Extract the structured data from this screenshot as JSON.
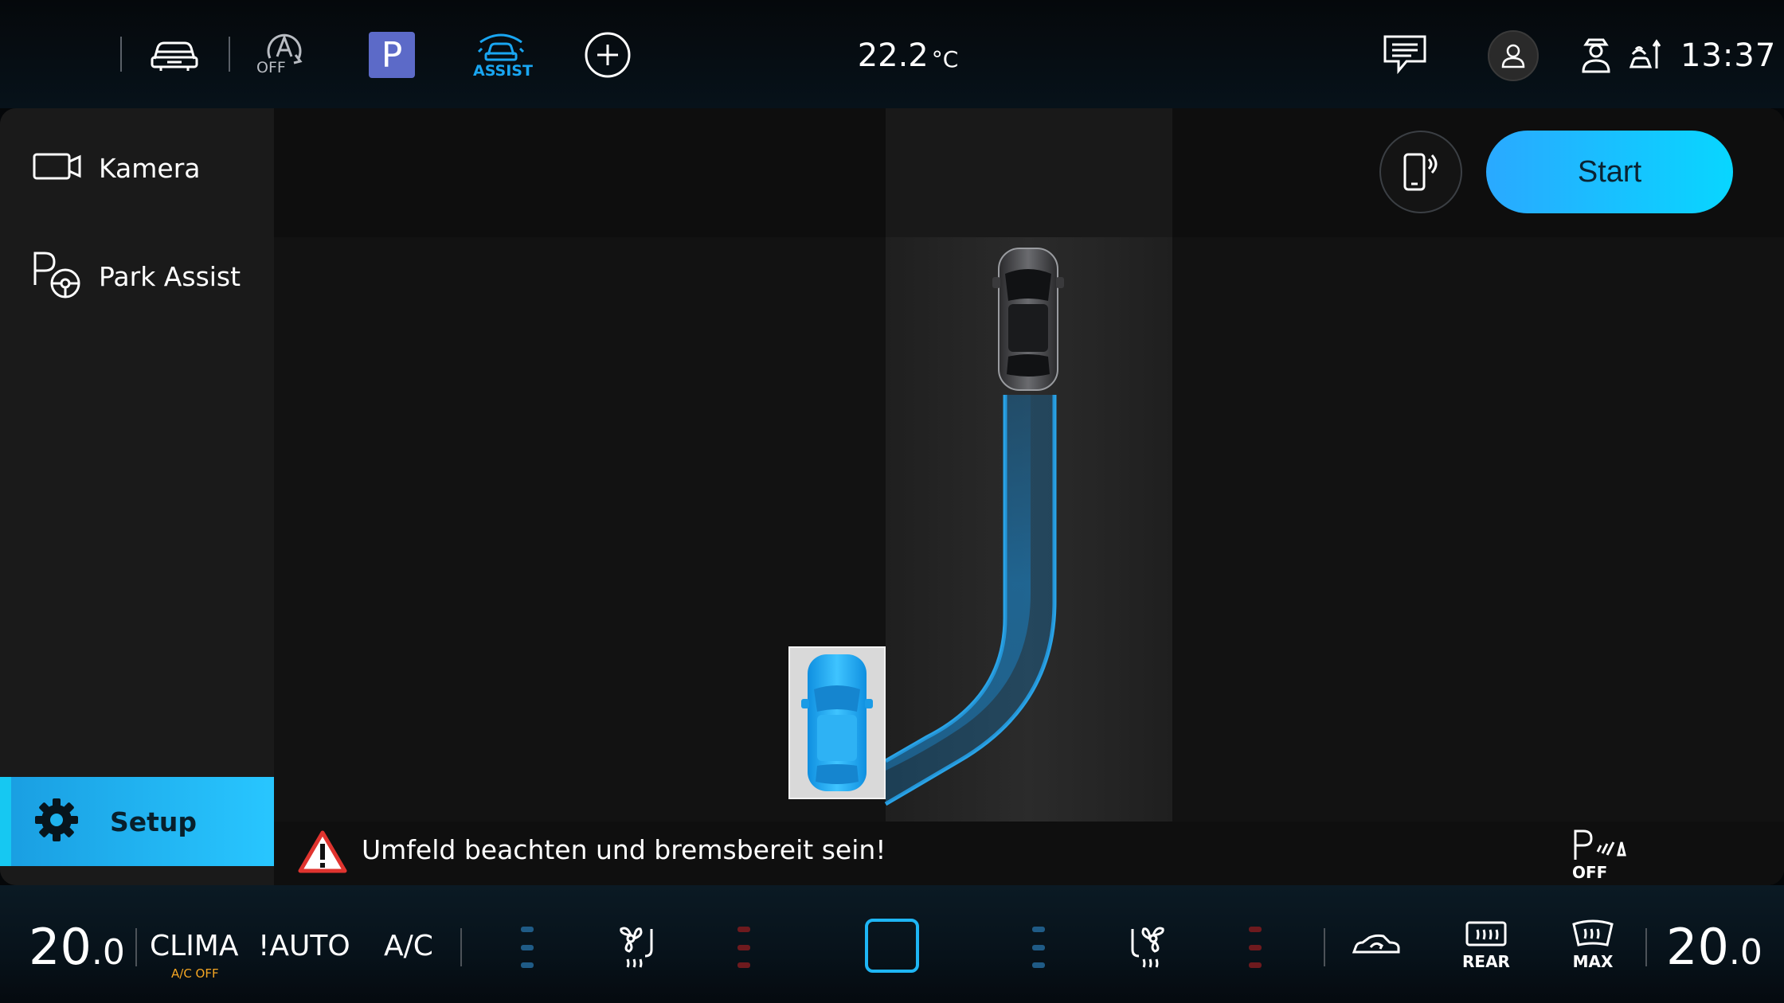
{
  "status_bar": {
    "apps_icon": "apps-grid-icon",
    "car_icon": "car-icon",
    "auto_hold_label": "OFF",
    "park_label": "P",
    "assist_label": "ASSIST",
    "add_icon": "plus-circle-icon",
    "temperature": "22.2",
    "temperature_unit": "°C",
    "messages_icon": "message-icon",
    "profile_icon": "user-icon",
    "clock": "13:37"
  },
  "sidebar": {
    "items": [
      {
        "label": "Kamera",
        "icon": "camera-icon"
      },
      {
        "label": "Park Assist",
        "icon": "park-assist-icon"
      }
    ],
    "setup": {
      "label": "Setup",
      "icon": "gear-icon"
    }
  },
  "main": {
    "start_label": "Start",
    "phone_icon": "phone-remote-icon",
    "warning": "Umfeld beachten und bremsbereit sein!",
    "park_off_label": "OFF"
  },
  "climate": {
    "left_temp_int": "20",
    "left_temp_dec": ".0",
    "clima_label": "CLIMA",
    "clima_sub": "A/C OFF",
    "auto_label": "!AUTO",
    "ac_label": "A/C",
    "rear_label": "REAR",
    "max_label": "MAX",
    "right_temp_int": "20",
    "right_temp_dec": ".0"
  },
  "colors": {
    "accent": "#19a6f2",
    "start_button": "#08d6ff",
    "park_p": "#5c6ac8",
    "warning": "#e0342f",
    "heat_red": "#6e1a1e",
    "cool_blue": "#1f5b86"
  }
}
